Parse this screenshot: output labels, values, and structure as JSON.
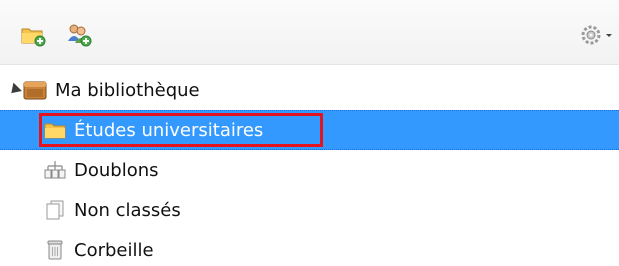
{
  "toolbar": {
    "new_collection_icon": "new-collection-icon",
    "new_group_icon": "new-group-icon",
    "settings_icon": "gear-icon"
  },
  "tree": {
    "library_label": "Ma bibliothèque",
    "items": [
      {
        "label": "Études universitaires",
        "icon": "folder-icon",
        "selected": true
      },
      {
        "label": "Doublons",
        "icon": "duplicates-icon",
        "selected": false
      },
      {
        "label": "Non classés",
        "icon": "unfiled-icon",
        "selected": false
      },
      {
        "label": "Corbeille",
        "icon": "trash-icon",
        "selected": false
      }
    ]
  },
  "colors": {
    "selection": "#3399ff",
    "highlight_box": "#e3141d"
  }
}
